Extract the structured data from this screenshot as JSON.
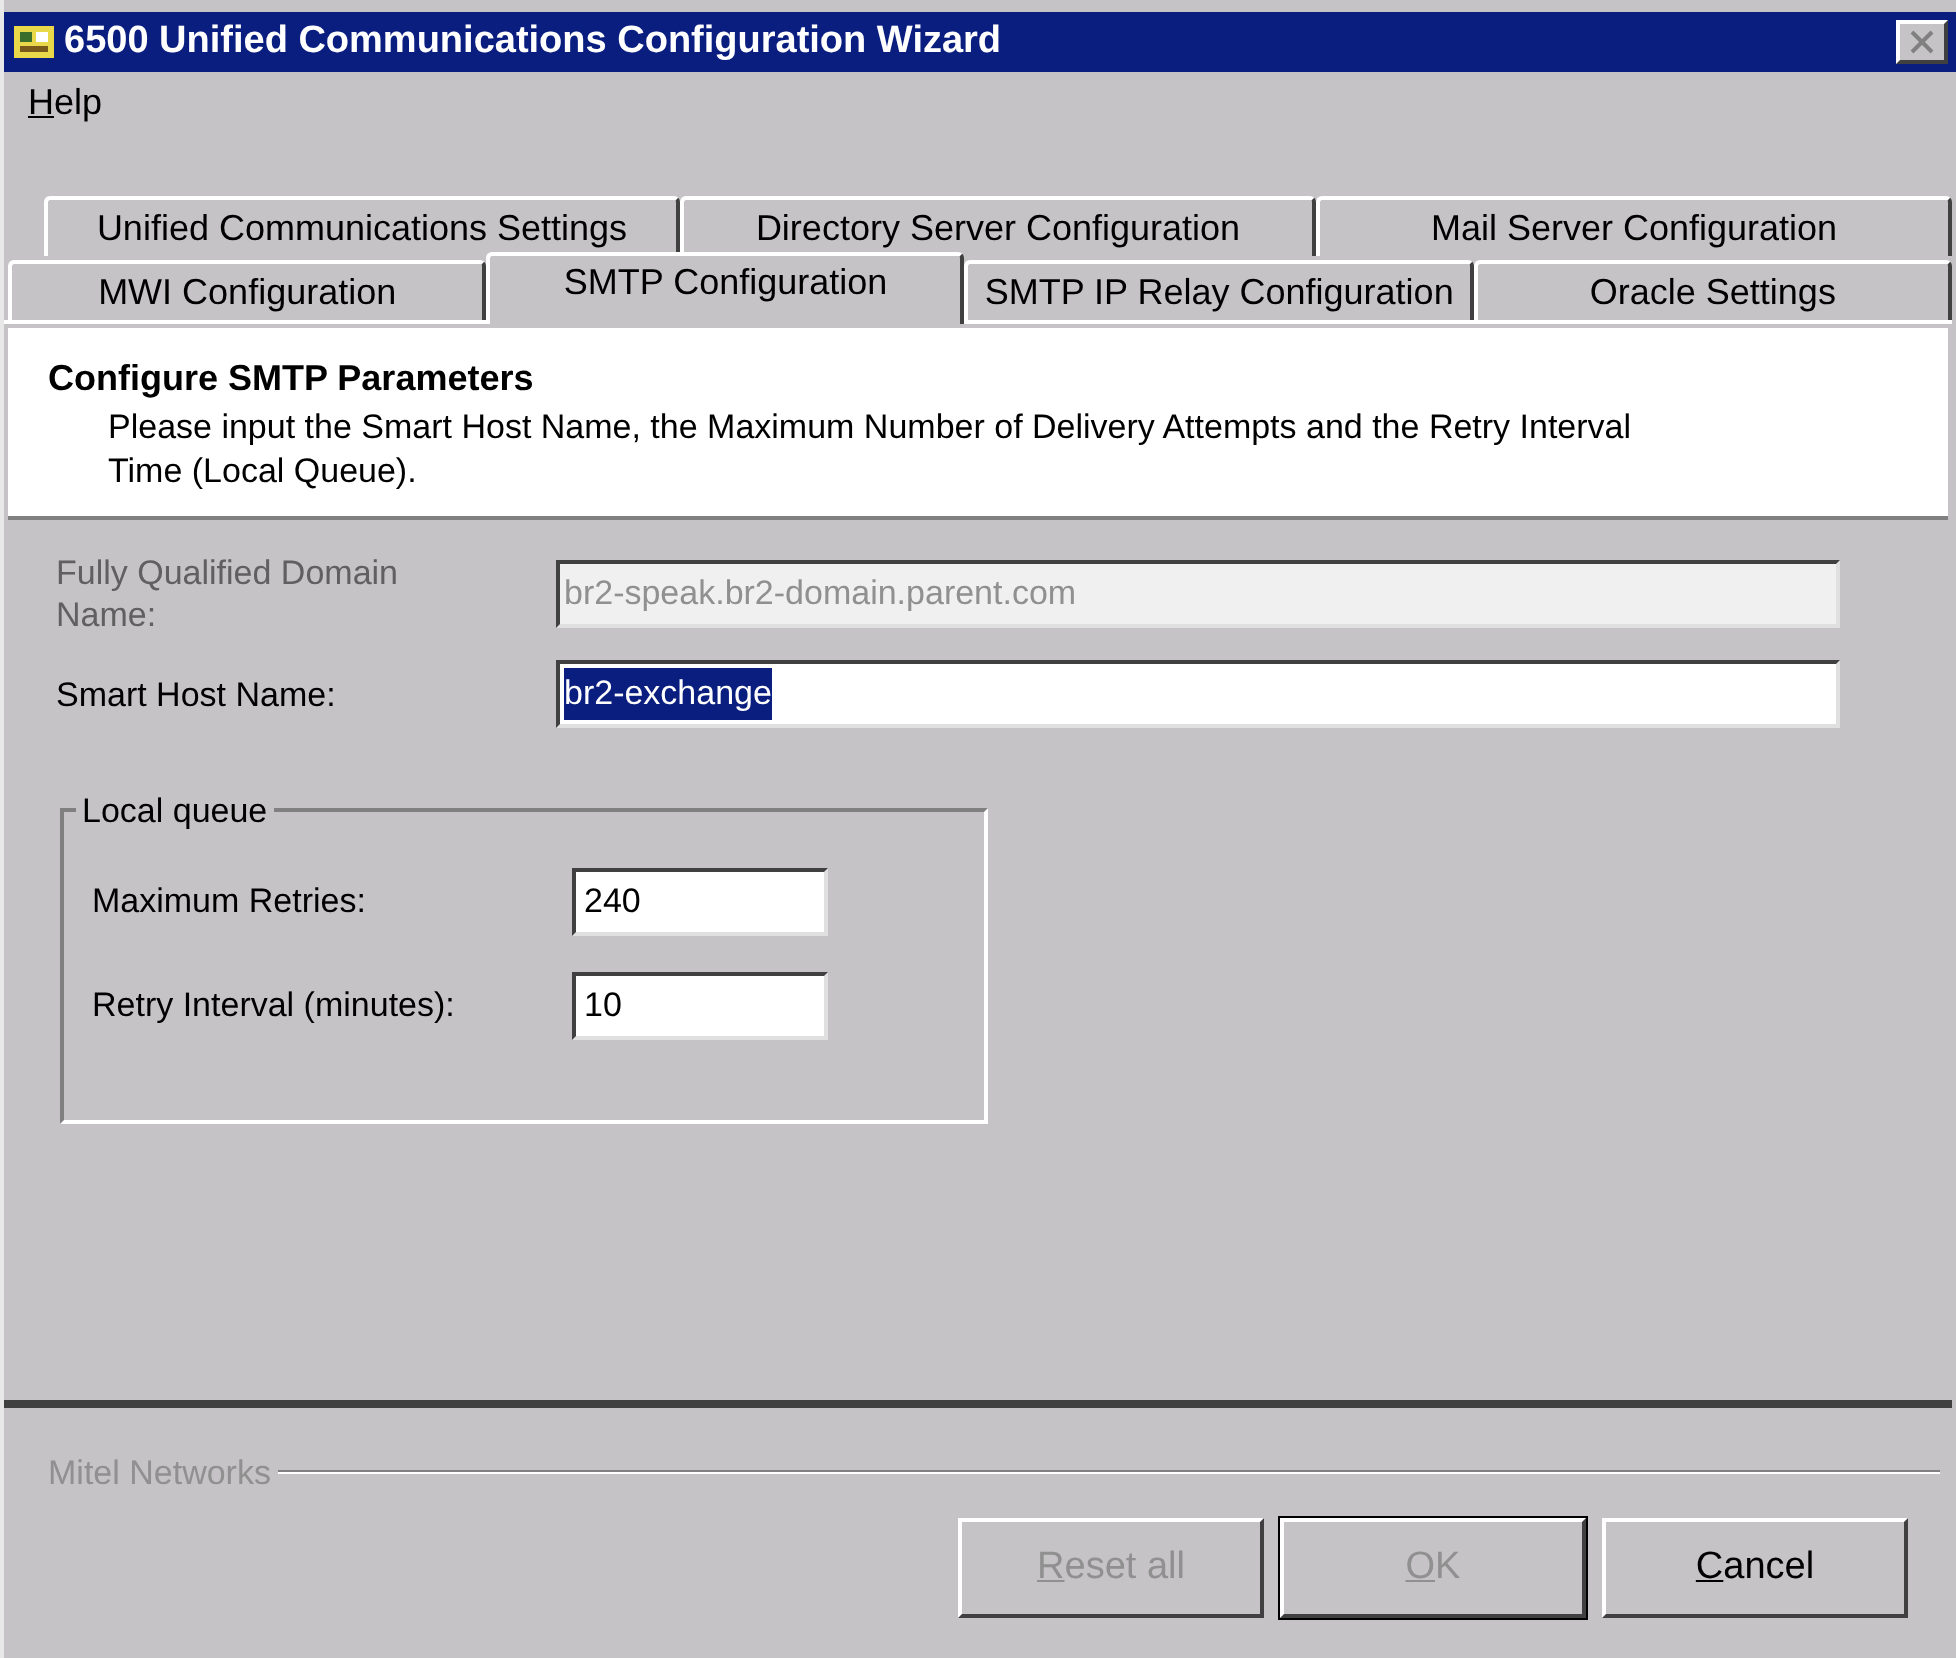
{
  "window": {
    "title": "6500 Unified Communications Configuration Wizard"
  },
  "menu": [
    {
      "label": "Help",
      "mnemonic": true
    }
  ],
  "tab_rows": [
    [
      {
        "label": "Unified Communications Settings",
        "selected": false
      },
      {
        "label": "Directory Server Configuration",
        "selected": false
      },
      {
        "label": "Mail Server Configuration",
        "selected": false
      }
    ],
    [
      {
        "label": "MWI Configuration",
        "selected": false
      },
      {
        "label": "SMTP Configuration",
        "selected": true
      },
      {
        "label": "SMTP IP Relay Configuration",
        "selected": false
      },
      {
        "label": "Oracle Settings",
        "selected": false
      }
    ]
  ],
  "header": {
    "title": "Configure SMTP Parameters",
    "description": "Please input the Smart Host Name, the Maximum Number of Delivery Attempts and the Retry Interval Time (Local Queue)."
  },
  "fields": [
    {
      "label": "Fully Qualified Domain Name:",
      "value": "br2-speak.br2-domain.parent.com",
      "disabled": true,
      "selected": false
    },
    {
      "label": "Smart Host Name:",
      "value": "br2-exchange",
      "disabled": false,
      "selected": true
    }
  ],
  "local_queue": {
    "title": "Local queue",
    "fields": [
      {
        "label": "Maximum Retries:",
        "value": "240"
      },
      {
        "label": "Retry Interval (minutes):",
        "value": "10"
      }
    ]
  },
  "footer": {
    "brand": "Mitel Networks"
  },
  "buttons": [
    {
      "label": "Reset all",
      "disabled": true,
      "default": false,
      "mnemonic": true
    },
    {
      "label": "OK",
      "disabled": true,
      "default": true,
      "mnemonic": true
    },
    {
      "label": "Cancel",
      "disabled": false,
      "default": false,
      "mnemonic": true
    }
  ]
}
